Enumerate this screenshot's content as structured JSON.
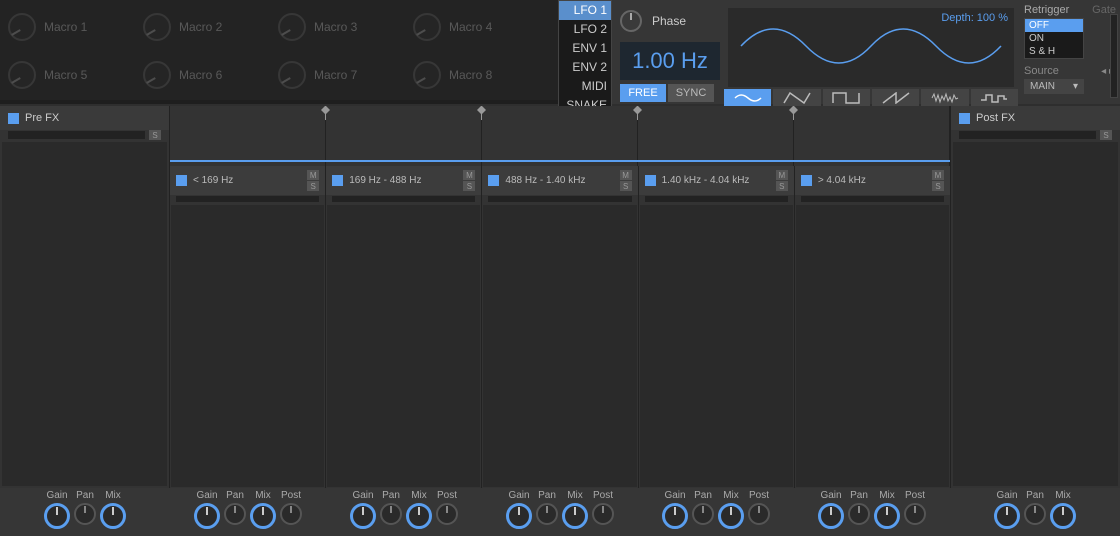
{
  "macros": [
    {
      "label": "Macro 1"
    },
    {
      "label": "Macro 2"
    },
    {
      "label": "Macro 3"
    },
    {
      "label": "Macro 4"
    },
    {
      "label": "Macro 5"
    },
    {
      "label": "Macro 6"
    },
    {
      "label": "Macro 7"
    },
    {
      "label": "Macro 8"
    }
  ],
  "mod_sources": [
    "LFO 1",
    "LFO 2",
    "ENV 1",
    "ENV 2",
    "MIDI",
    "SNAKE"
  ],
  "mod_selected": 0,
  "phase": {
    "label": "Phase",
    "freq": "1.00 Hz",
    "modes": [
      "FREE",
      "SYNC"
    ],
    "mode_selected": 0
  },
  "depth": "Depth: 100 %",
  "retrigger": {
    "label": "Retrigger",
    "gate_label": "Gate",
    "options": [
      "OFF",
      "ON",
      "S & H"
    ],
    "selected": 0,
    "source_label": "Source",
    "source_value": "MAIN"
  },
  "prefx": {
    "title": "Pre FX"
  },
  "postfx": {
    "title": "Post FX"
  },
  "ms": {
    "m": "M",
    "s": "S"
  },
  "bands": [
    {
      "label": "< 169 Hz"
    },
    {
      "label": "169 Hz - 488 Hz"
    },
    {
      "label": "488 Hz - 1.40 kHz"
    },
    {
      "label": "1.40 kHz - 4.04 kHz"
    },
    {
      "label": "> 4.04 kHz"
    }
  ],
  "knobs": {
    "gain": "Gain",
    "pan": "Pan",
    "mix": "Mix",
    "post": "Post"
  }
}
